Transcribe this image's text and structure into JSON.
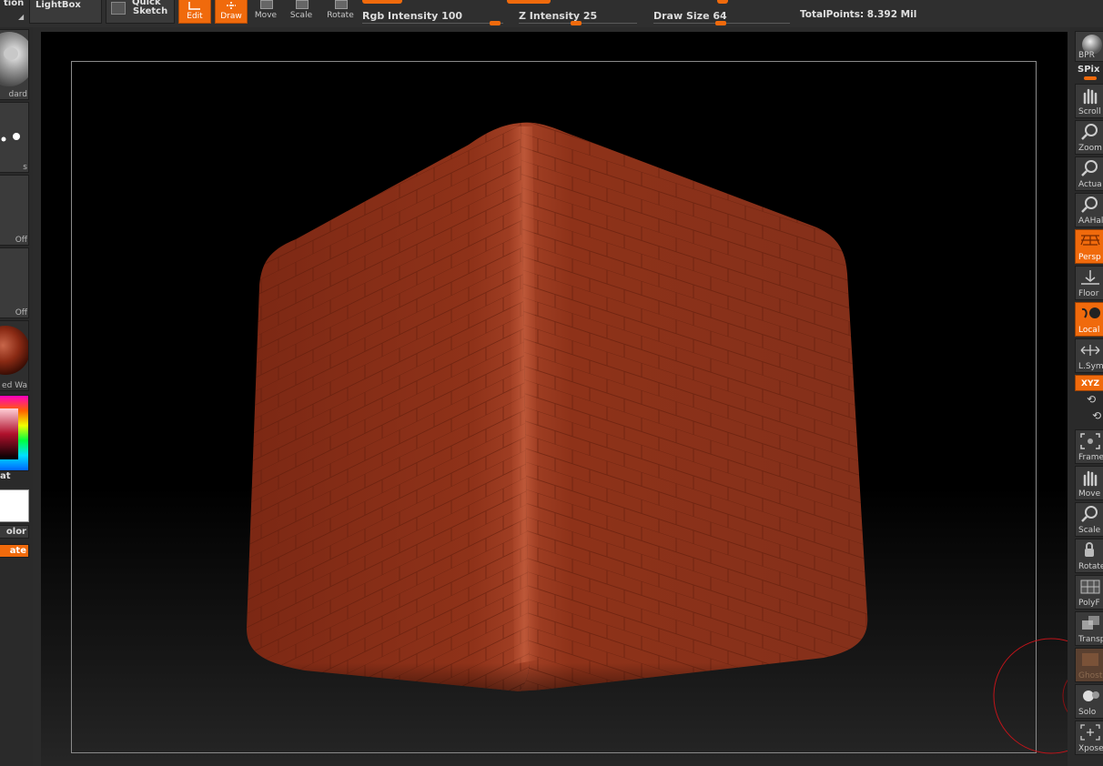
{
  "topbar": {
    "left_cut_label": "tion",
    "lightbox_label": "LightBox",
    "quick_sketch_label": [
      "Quick",
      "Sketch"
    ],
    "edit_label": "Edit",
    "draw_label": "Draw",
    "move_label": "Move",
    "scale_label": "Scale",
    "rotate_label": "Rotate",
    "rgb_intensity_label": "Rgb Intensity 100",
    "rgb_intensity_value": 100,
    "z_intensity_label": "Z Intensity 25",
    "z_intensity_value": 25,
    "draw_size_label": "Draw Size 64",
    "draw_size_value": 64,
    "total_points": "TotalPoints: 8.392 Mil"
  },
  "left_shelf": {
    "brush_label": "dard",
    "stroke_label": "s",
    "alpha_label": "Off",
    "texture_label": "Off",
    "material_label": "ed Wa",
    "gradient_label": "at",
    "color_btn_label": "olor",
    "rotate_btn_label": "ate"
  },
  "right_shelf": {
    "items": [
      {
        "label": "BPR"
      },
      {
        "label": "SPix"
      },
      {
        "label": "Scroll"
      },
      {
        "label": "Zoom"
      },
      {
        "label": "Actua"
      },
      {
        "label": "AAHal"
      },
      {
        "label": "Persp"
      },
      {
        "label": "Floor"
      },
      {
        "label": "Local"
      },
      {
        "label": "L.Sym"
      },
      {
        "label": "XYZ"
      },
      {
        "label": "Frame"
      },
      {
        "label": "Move"
      },
      {
        "label": "Scale"
      },
      {
        "label": "Rotate"
      },
      {
        "label": "PolyF"
      },
      {
        "label": "Transp"
      },
      {
        "label": "Ghost"
      },
      {
        "label": "Solo"
      },
      {
        "label": "Xpose"
      }
    ]
  },
  "colors": {
    "accent": "#f06a0c",
    "brick": "#8a2e17",
    "panel": "#2b2b2b"
  }
}
